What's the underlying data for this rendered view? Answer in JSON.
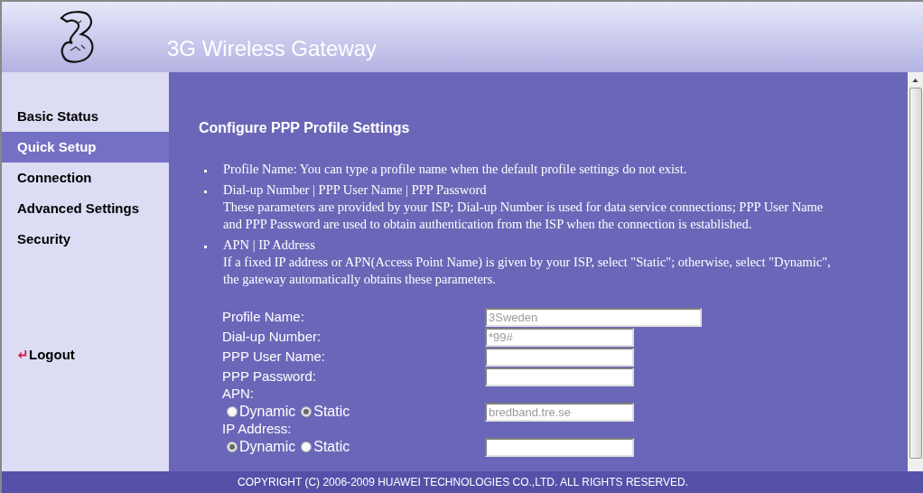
{
  "header": {
    "title": "3G Wireless Gateway"
  },
  "sidebar": {
    "items": [
      {
        "label": "Basic Status",
        "selected": false
      },
      {
        "label": "Quick Setup",
        "selected": true
      },
      {
        "label": "Connection",
        "selected": false
      },
      {
        "label": "Advanced Settings",
        "selected": false
      },
      {
        "label": "Security",
        "selected": false
      }
    ],
    "logout": "Logout"
  },
  "content": {
    "heading": "Configure PPP Profile Settings",
    "notes": [
      {
        "title": "Profile Name: You can type a profile name when the default profile settings do not exist."
      },
      {
        "title": "Dial-up Number | PPP User Name | PPP Password",
        "text": "These parameters are provided by your ISP; Dial-up Number is used for data service connections; PPP User Name and PPP Password are used to obtain authentication from the ISP when the connection is established."
      },
      {
        "title": "APN | IP Address",
        "text": "If a fixed IP address or APN(Access Point Name) is given by your ISP, select \"Static\"; otherwise, select \"Dynamic\", the gateway automatically obtains these parameters."
      }
    ],
    "fields": [
      {
        "kind": "text",
        "label": "Profile Name:",
        "value": "3Sweden",
        "wide": true
      },
      {
        "kind": "text",
        "label": "Dial-up Number:",
        "value": "*99#"
      },
      {
        "kind": "text",
        "label": "PPP User Name:"
      },
      {
        "kind": "text",
        "label": "PPP Password:"
      },
      {
        "kind": "radio",
        "label": "APN:",
        "options": [
          {
            "label": "Dynamic",
            "selected": false
          },
          {
            "label": "Static",
            "selected": true
          }
        ],
        "value": "bredband.tre.se"
      },
      {
        "kind": "radio",
        "label": "IP Address:",
        "options": [
          {
            "label": "Dynamic",
            "selected": true
          },
          {
            "label": "Static",
            "selected": false
          }
        ]
      }
    ]
  },
  "footer": "COPYRIGHT (C) 2006-2009 HUAWEI TECHNOLOGIES CO.,LTD. ALL RIGHTS RESERVED."
}
